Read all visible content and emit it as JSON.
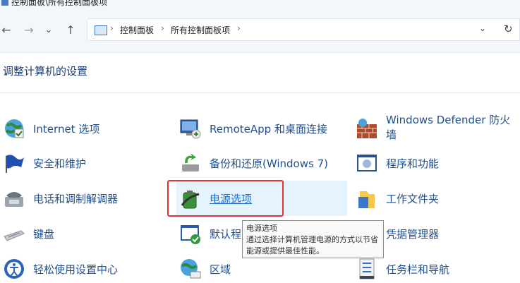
{
  "window": {
    "title": "控制面板\\所有控制面板项"
  },
  "nav": {
    "back": "←",
    "forward": "→",
    "recent": "⌄",
    "up": "↑"
  },
  "address": {
    "crumb1": "控制面板",
    "crumb2": "所有控制面板项",
    "sep": "›",
    "dropdown": "⌄",
    "refresh": "↻"
  },
  "heading": "调整计算机的设置",
  "items": {
    "internet": "Internet 选项",
    "remoteapp": "RemoteApp 和桌面连接",
    "defender": "Windows Defender 防火墙",
    "security": "安全和维护",
    "backup": "备份和还原(Windows 7)",
    "programs": "程序和功能",
    "phone": "电话和调制解调器",
    "power": "电源选项",
    "workfolders": "工作文件夹",
    "keyboard": "键盘",
    "defaults": "默认程",
    "credentials": "凭据管理器",
    "ease": "轻松使用设置中心",
    "region": "区域",
    "taskbar": "任务栏和导航"
  },
  "tooltip": {
    "title": "电源选项",
    "body": "通过选择计算机管理电源的方式以节省能源或提供最佳性能。"
  },
  "colors": {
    "highlight": "#e33535",
    "hover": "#e5f3ff",
    "link": "#1f4f8f"
  }
}
